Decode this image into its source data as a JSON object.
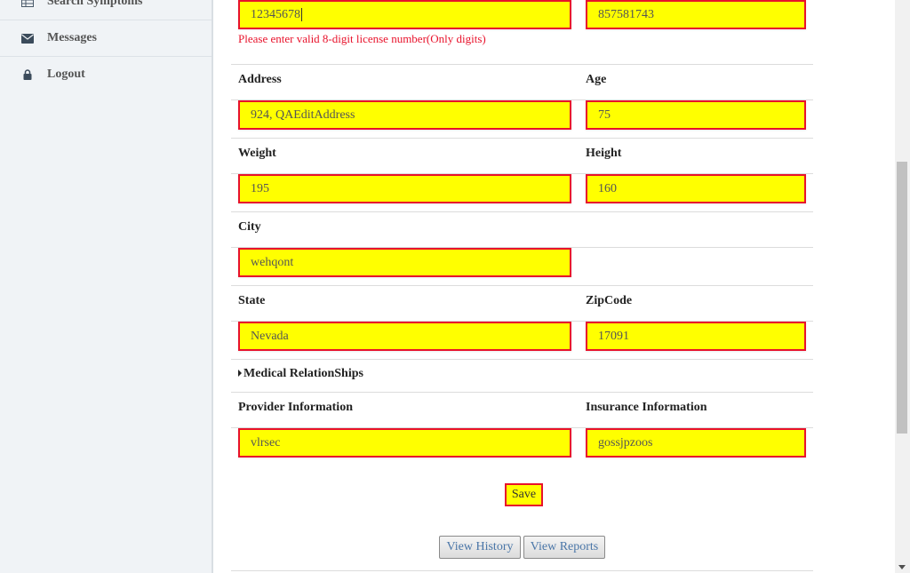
{
  "sidebar": {
    "items": [
      {
        "label": "Search Symptoms",
        "icon": "table-icon"
      },
      {
        "label": "Messages",
        "icon": "envelope-icon"
      },
      {
        "label": "Logout",
        "icon": "lock-icon"
      }
    ]
  },
  "form": {
    "license": {
      "value": "12345678",
      "error": "Please enter valid 8-digit license number(Only digits)"
    },
    "phone": {
      "value": "857581743"
    },
    "address": {
      "label": "Address",
      "value": "924, QAEditAddress"
    },
    "age": {
      "label": "Age",
      "value": "75"
    },
    "weight": {
      "label": "Weight",
      "value": "195"
    },
    "height": {
      "label": "Height",
      "value": "160"
    },
    "city": {
      "label": "City",
      "value": "wehqont"
    },
    "state": {
      "label": "State",
      "value": "Nevada"
    },
    "zipcode": {
      "label": "ZipCode",
      "value": "17091"
    },
    "medical_relationships": {
      "label": "Medical RelationShips"
    },
    "provider": {
      "label": "Provider Information",
      "value": "vlrsec"
    },
    "insurance": {
      "label": "Insurance Information",
      "value": "gossjpzoos"
    },
    "save_label": "Save",
    "view_history_label": "View History",
    "view_reports_label": "View Reports"
  },
  "colors": {
    "field_bg": "#ffff00",
    "field_border": "#e8122b",
    "error_text": "#e8122b",
    "link_text": "#4a76a8"
  }
}
